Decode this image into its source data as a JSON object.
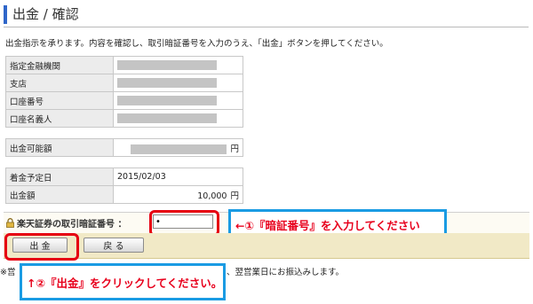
{
  "page": {
    "title": "出金 / 確認",
    "instruction": "出金指示を承ります。内容を確認し、取引暗証番号を入力のうえ、「出金」ボタンを押してください。"
  },
  "account_table": {
    "rows": [
      {
        "label": "指定金融機関",
        "value": ""
      },
      {
        "label": "支店",
        "value": ""
      },
      {
        "label": "口座番号",
        "value": ""
      },
      {
        "label": "口座名義人",
        "value": ""
      }
    ]
  },
  "available": {
    "label": "出金可能額",
    "unit": "円"
  },
  "withdraw_detail": {
    "date_label": "着金予定日",
    "date_value": "2015/02/03",
    "amount_label": "出金額",
    "amount_value": "10,000",
    "unit": "円"
  },
  "pin": {
    "label": "楽天証券の取引暗証番号 ：",
    "value": "|"
  },
  "buttons": {
    "withdraw": "出 金",
    "back": "戻 る"
  },
  "annotations": {
    "callout1": "←①『暗証番号』を入力してください",
    "callout2": "↑②『出金』をクリックしてください。"
  },
  "footer": {
    "prefix": "※営",
    "suffix": "、翌営業日にお振込みします。"
  },
  "colors": {
    "accent": "#2f66c9",
    "highlight_red": "#e60012",
    "callout_blue": "#1a9be3",
    "button_bar": "#f1e9c6"
  }
}
